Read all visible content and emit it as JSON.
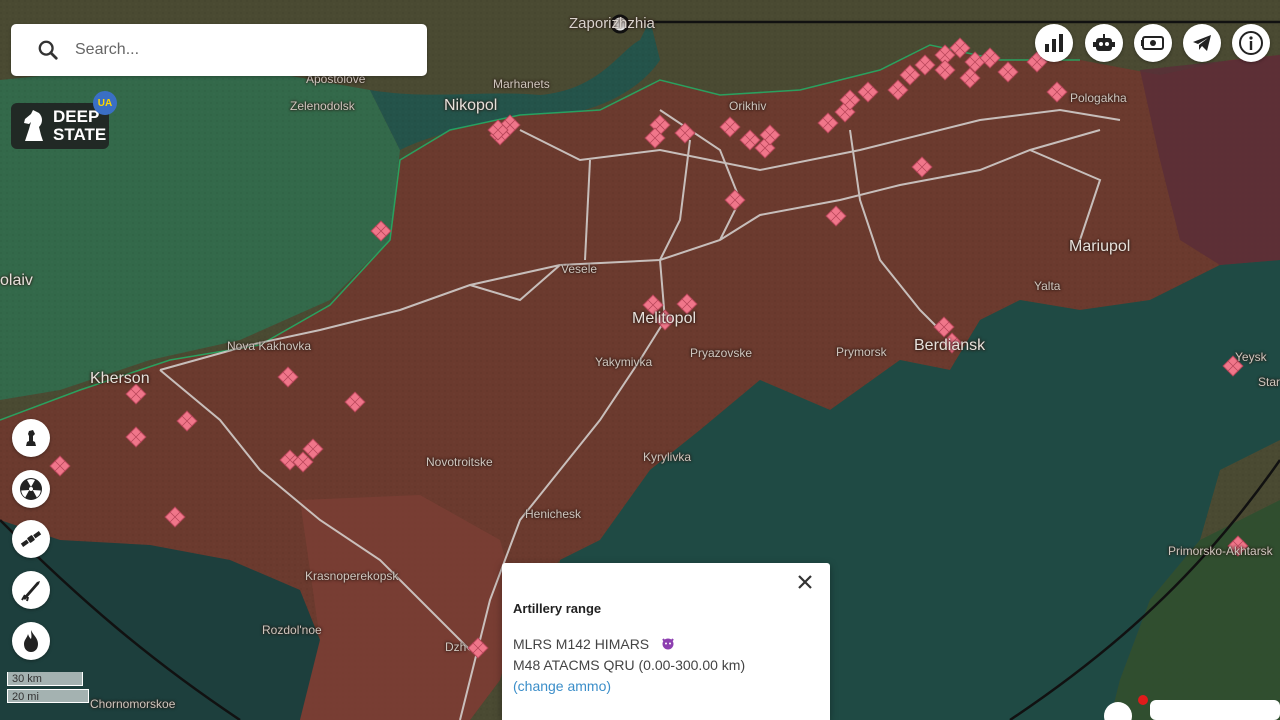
{
  "search": {
    "placeholder": "Search..."
  },
  "logo": {
    "line1": "DEEP",
    "line2": "STATE",
    "badge": "UA"
  },
  "toolbar_right": [
    {
      "name": "statistics-button",
      "icon": "bar-chart-icon"
    },
    {
      "name": "bot-button",
      "icon": "robot-icon"
    },
    {
      "name": "donate-button",
      "icon": "money-icon"
    },
    {
      "name": "telegram-button",
      "icon": "telegram-icon"
    },
    {
      "name": "info-button",
      "icon": "info-icon"
    }
  ],
  "toolbar_left": [
    {
      "name": "chess-layer-button",
      "icon": "chess-rook-icon"
    },
    {
      "name": "nuclear-layer-button",
      "icon": "radiation-icon"
    },
    {
      "name": "satellite-layer-button",
      "icon": "satellite-icon"
    },
    {
      "name": "artillery-layer-button",
      "icon": "rocket-launcher-icon"
    },
    {
      "name": "fire-layer-button",
      "icon": "fire-icon"
    }
  ],
  "scale": {
    "km": "30 km",
    "mi": "20 mi"
  },
  "cities": {
    "zaporizhzhia": "Zaporizhzhia",
    "apostolove": "Apostolove",
    "marhanets": "Marhanets",
    "orikhiv": "Orikhiv",
    "zelenodolsk": "Zelenodolsk",
    "nikopol": "Nikopol",
    "polohy": "Pologakha",
    "mariupol": "Mariupol",
    "mykolaiv": "olaiv",
    "vesele": "Vesele",
    "yalta": "Yalta",
    "melitopol": "Melitopol",
    "nova_kakhovka": "Nova Kakhovka",
    "kherson": "Kherson",
    "yakymivka": "Yakymivka",
    "pryazovske": "Pryazovske",
    "prymorsk": "Prymorsk",
    "berdiansk": "Berdiansk",
    "yeysk": "Yeysk",
    "star": "Star",
    "kyrylivka": "Kyrylivka",
    "novotroitske": "Novotroitske",
    "henichesk": "Henichesk",
    "krasnoperekopsk": "Krasnoperekopsk",
    "rozdolnoe": "Rozdol'noe",
    "dzhankoi": "Dzh",
    "chornomorskoe": "Chornomorskoe",
    "primorsko": "Primorsko-Akhtarsk"
  },
  "popup": {
    "title": "Artillery range",
    "line1": "MLRS M142 HIMARS",
    "line2": "M48 ATACMS QRU (0.00-300.00 km)",
    "link": "(change ammo)"
  },
  "colors": {
    "occupied": "#6b3a2e",
    "liberated": "#2f6e4f",
    "sea": "#1f4a44",
    "target": "#f0768a",
    "road": "#d8d6d4"
  }
}
